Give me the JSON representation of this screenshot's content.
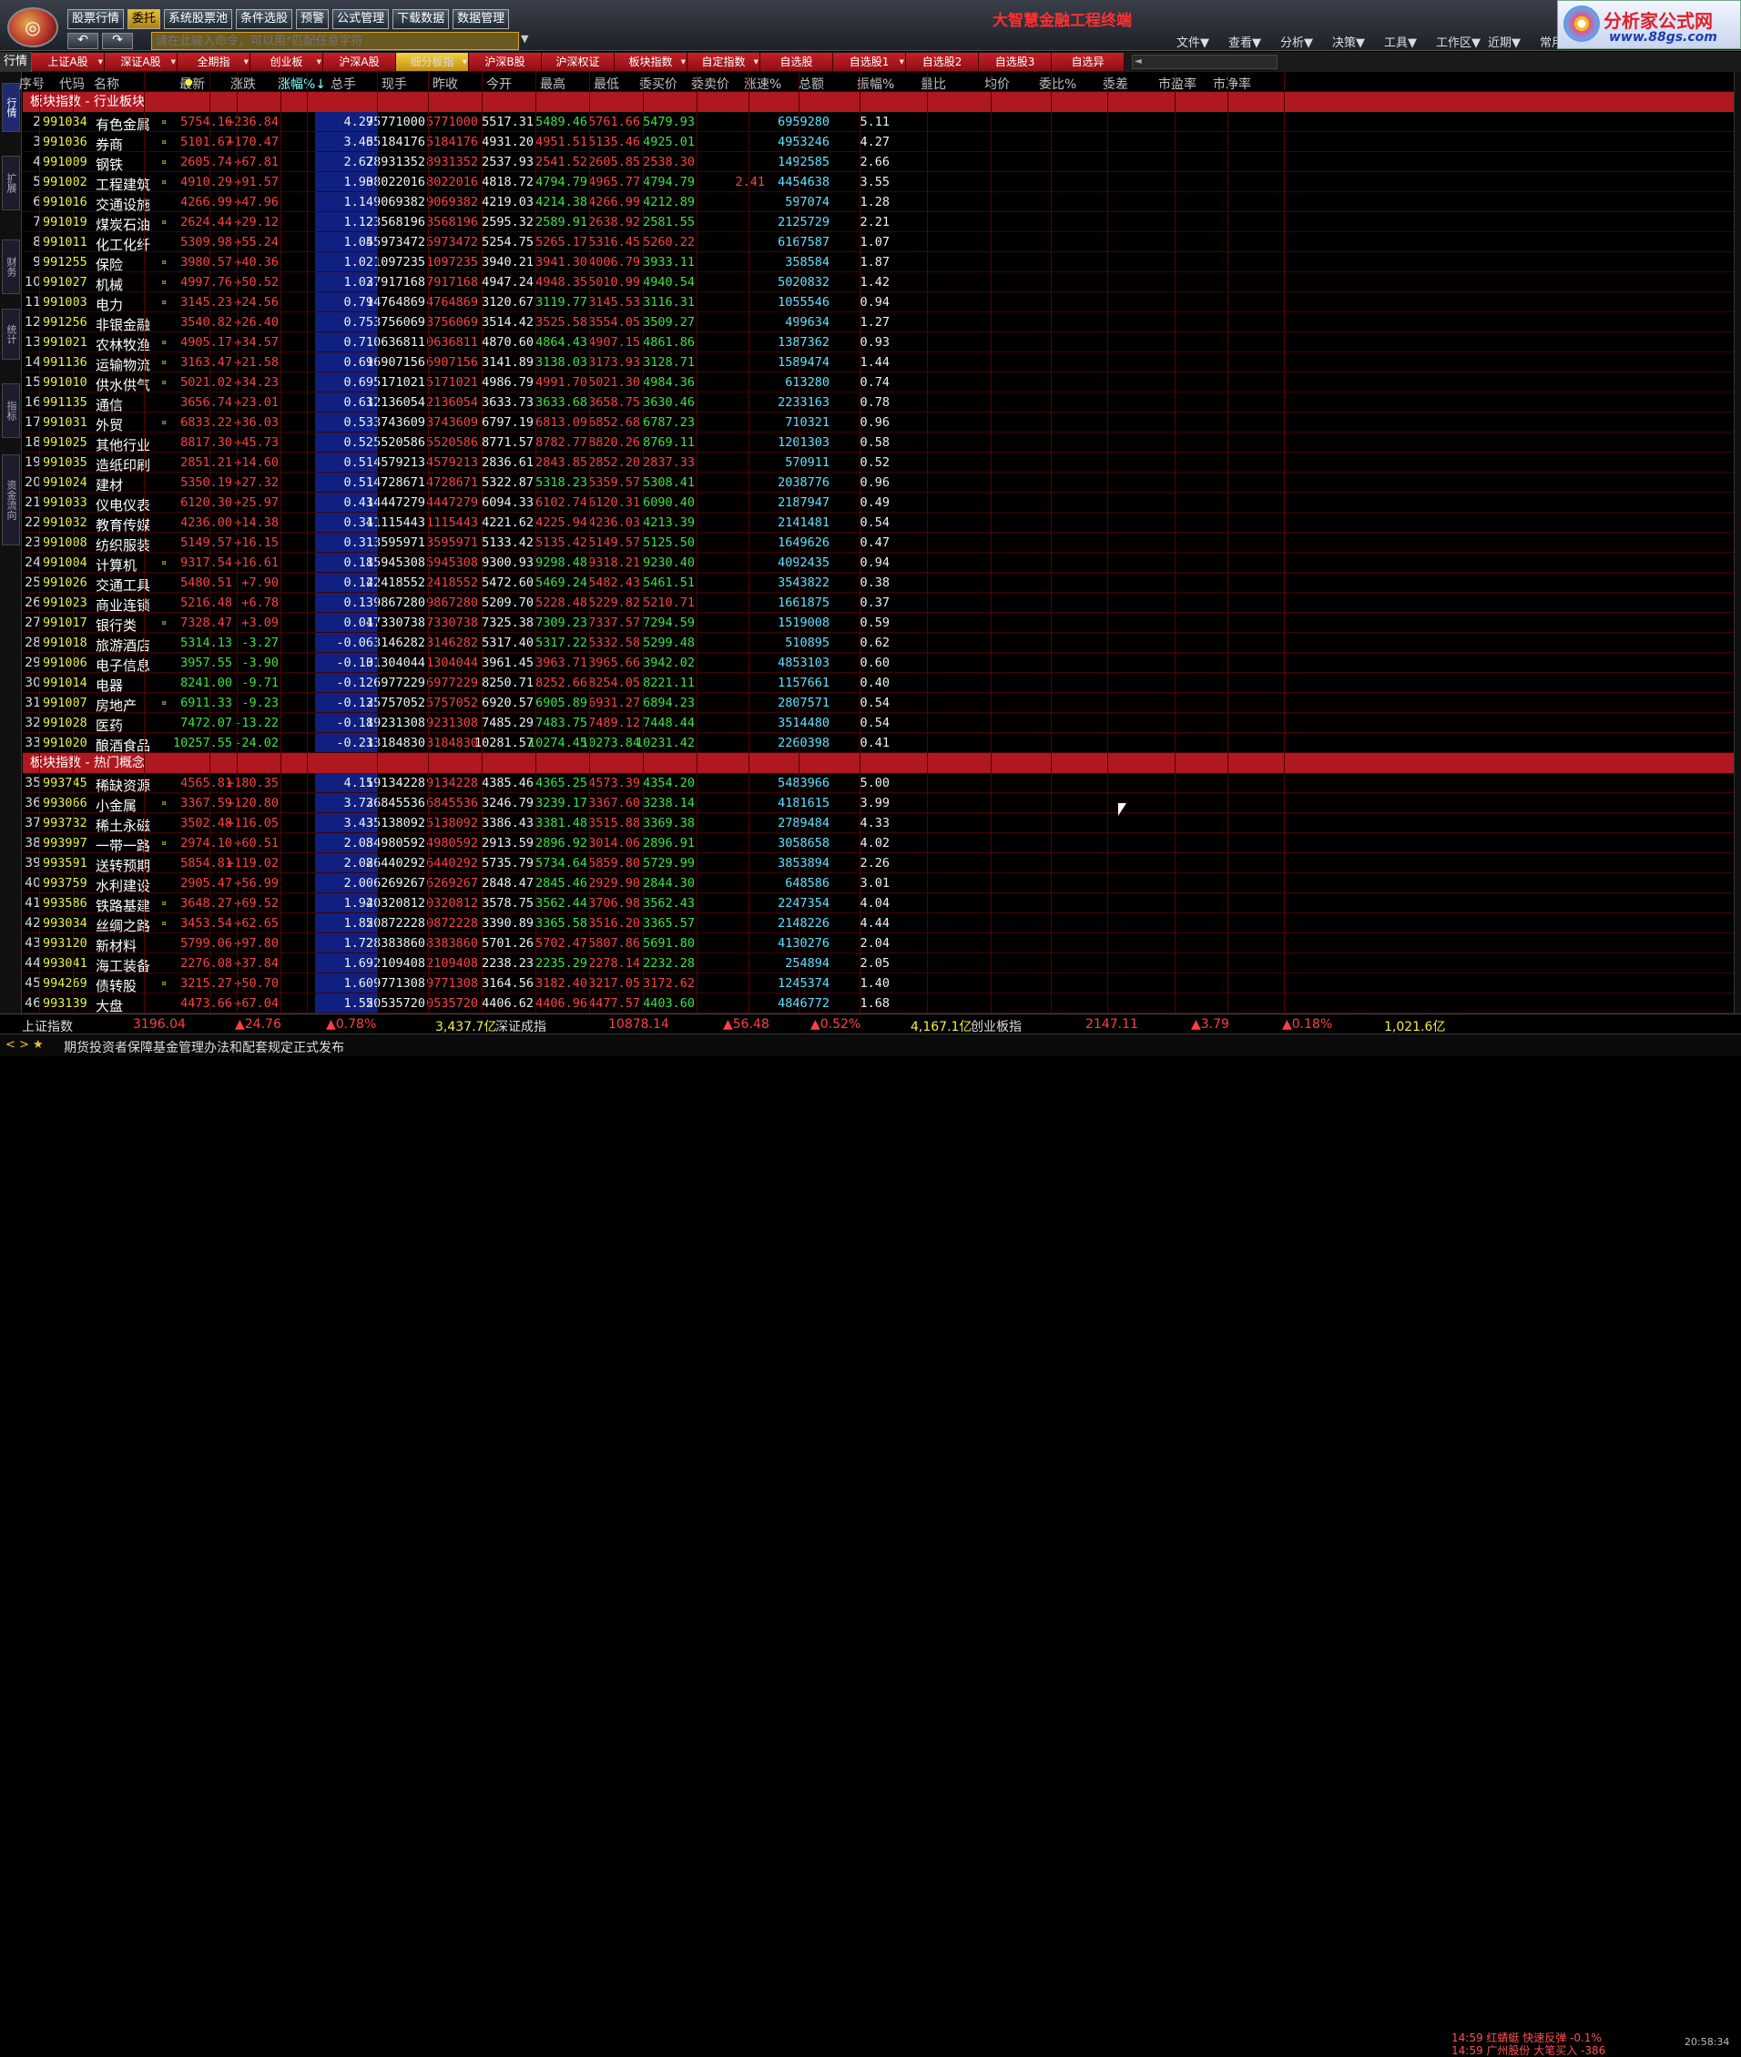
{
  "menu": [
    "股票行情",
    "委托",
    "系统股票池",
    "条件选股",
    "预警",
    "公式管理",
    "下载数据",
    "数据管理"
  ],
  "menu_active": "委托",
  "nav": {
    "back": "↶",
    "forward": "↷"
  },
  "command": {
    "placeholder": "请在此输入命令，可以用*匹配任意字符"
  },
  "app_title": "大智慧金融工程终端",
  "right_menu": [
    "文件▼",
    "查看▼",
    "分析▼",
    "决策▼",
    "工具▼",
    "工作区▼",
    "近期▼",
    "常用"
  ],
  "ad": {
    "line1": "分析家公式网",
    "line2": "www.88gs.com"
  },
  "tab_lead": "行情",
  "tabs": [
    "上证A股",
    "深证A股",
    "全期指",
    "创业板",
    "沪深A股",
    "细分板指",
    "沪深B股",
    "沪深权证",
    "板块指数",
    "自定指数",
    "自选股",
    "自选股1",
    "自选股2",
    "自选股3",
    "自选异"
  ],
  "tab_active": "细分板指",
  "side_tabs": [
    "行情",
    "扩展",
    "财务",
    "统计",
    "指标",
    "资金流向"
  ],
  "headers": [
    "序号",
    "代码",
    "名称",
    "最新",
    "涨跌",
    "涨幅%↓",
    "总手",
    "现手",
    "昨收",
    "今开",
    "最高",
    "最低",
    "委买价",
    "委卖价",
    "涨速%",
    "总额",
    "振幅%",
    "量比",
    "均价",
    "委比%",
    "委差",
    "市盈率",
    "市净率"
  ],
  "sort_header": "涨幅%↓",
  "header_mark": "●",
  "sections": [
    {
      "title": "板块指数 - 行业板块",
      "rows": [
        [
          "2",
          "991034",
          "有色金属",
          "¤",
          "5754.16",
          "+236.84",
          "4.29",
          "75771000",
          "5771000",
          "5517.31",
          "5489.46",
          "5761.66",
          "5479.93",
          "",
          "6959280",
          "5.11"
        ],
        [
          "3",
          "991036",
          "券商",
          "¤",
          "5101.67",
          "+170.47",
          "3.46",
          "35184176",
          "5184176",
          "4931.20",
          "4951.51",
          "5135.46",
          "4925.01",
          "",
          "4953246",
          "4.27"
        ],
        [
          "4",
          "991009",
          "钢铁",
          "¤",
          "2605.74",
          "+67.81",
          "2.67",
          "28931352",
          "8931352",
          "2537.93",
          "2541.52",
          "2605.85",
          "2538.30",
          "",
          "1492585",
          "2.66"
        ],
        [
          "5",
          "991002",
          "工程建筑",
          "¤",
          "4910.29",
          "+91.57",
          "1.90",
          "38022016",
          "8022016",
          "4818.72",
          "4794.79",
          "4965.77",
          "4794.79",
          "2.41",
          "4454638",
          "3.55"
        ],
        [
          "6",
          "991016",
          "交通设施",
          "",
          "4266.99",
          "+47.96",
          "1.14",
          "9069382",
          "9069382",
          "4219.03",
          "4214.38",
          "4266.99",
          "4212.89",
          "",
          "597074",
          "1.28"
        ],
        [
          "7",
          "991019",
          "煤炭石油",
          "¤",
          "2624.44",
          "+29.12",
          "1.12",
          "23568196",
          "3568196",
          "2595.32",
          "2589.91",
          "2638.92",
          "2581.55",
          "",
          "2125729",
          "2.21"
        ],
        [
          "8",
          "991011",
          "化工化纤",
          "",
          "5309.98",
          "+55.24",
          "1.05",
          "45973472",
          "5973472",
          "5254.75",
          "5265.17",
          "5316.45",
          "5260.22",
          "",
          "6167587",
          "1.07"
        ],
        [
          "9",
          "991255",
          "保险",
          "¤",
          "3980.57",
          "+40.36",
          "1.02",
          "1097235",
          "1097235",
          "3940.21",
          "3941.30",
          "4006.79",
          "3933.11",
          "",
          "358584",
          "1.87"
        ],
        [
          "10",
          "991027",
          "机械",
          "¤",
          "4997.76",
          "+50.52",
          "1.02",
          "37917168",
          "7917168",
          "4947.24",
          "4948.35",
          "5010.99",
          "4940.54",
          "",
          "5020832",
          "1.42"
        ],
        [
          "11",
          "991003",
          "电力",
          "¤",
          "3145.23",
          "+24.56",
          "0.79",
          "14764869",
          "4764869",
          "3120.67",
          "3119.77",
          "3145.53",
          "3116.31",
          "",
          "1055546",
          "0.94"
        ],
        [
          "12",
          "991256",
          "非银金融",
          "",
          "3540.82",
          "+26.40",
          "0.75",
          "3756069",
          "3756069",
          "3514.42",
          "3525.58",
          "3554.05",
          "3509.27",
          "",
          "499634",
          "1.27"
        ],
        [
          "13",
          "991021",
          "农林牧渔",
          "¤",
          "4905.17",
          "+34.57",
          "0.71",
          "10636811",
          "0636811",
          "4870.60",
          "4864.43",
          "4907.15",
          "4861.86",
          "",
          "1387362",
          "0.93"
        ],
        [
          "14",
          "991136",
          "运输物流",
          "¤",
          "3163.47",
          "+21.58",
          "0.69",
          "16907156",
          "6907156",
          "3141.89",
          "3138.03",
          "3173.93",
          "3128.71",
          "",
          "1589474",
          "1.44"
        ],
        [
          "15",
          "991010",
          "供水供气",
          "¤",
          "5021.02",
          "+34.23",
          "0.69",
          "5171021",
          "5171021",
          "4986.79",
          "4991.70",
          "5021.30",
          "4984.36",
          "",
          "613280",
          "0.74"
        ],
        [
          "16",
          "991135",
          "通信",
          "",
          "3656.74",
          "+23.01",
          "0.63",
          "12136054",
          "2136054",
          "3633.73",
          "3633.68",
          "3658.75",
          "3630.46",
          "",
          "2233163",
          "0.78"
        ],
        [
          "17",
          "991031",
          "外贸",
          "¤",
          "6833.22",
          "+36.03",
          "0.53",
          "3743609",
          "3743609",
          "6797.19",
          "6813.09",
          "6852.68",
          "6787.23",
          "",
          "710321",
          "0.96"
        ],
        [
          "18",
          "991025",
          "其他行业",
          "",
          "8817.30",
          "+45.73",
          "0.52",
          "5520586",
          "5520586",
          "8771.57",
          "8782.77",
          "8820.26",
          "8769.11",
          "",
          "1201303",
          "0.58"
        ],
        [
          "19",
          "991035",
          "造纸印刷",
          "",
          "2851.21",
          "+14.60",
          "0.51",
          "4579213",
          "4579213",
          "2836.61",
          "2843.85",
          "2852.20",
          "2837.33",
          "",
          "570911",
          "0.52"
        ],
        [
          "20",
          "991024",
          "建材",
          "",
          "5350.19",
          "+27.32",
          "0.51",
          "14728671",
          "4728671",
          "5322.87",
          "5318.23",
          "5359.57",
          "5308.41",
          "",
          "2038776",
          "0.96"
        ],
        [
          "21",
          "991033",
          "仪电仪表",
          "",
          "6120.30",
          "+25.97",
          "0.43",
          "14447279",
          "4447279",
          "6094.33",
          "6102.74",
          "6120.31",
          "6090.40",
          "",
          "2187947",
          "0.49"
        ],
        [
          "22",
          "991032",
          "教育传媒",
          "",
          "4236.00",
          "+14.38",
          "0.34",
          "11115443",
          "1115443",
          "4221.62",
          "4225.94",
          "4236.03",
          "4213.39",
          "",
          "2141481",
          "0.54"
        ],
        [
          "23",
          "991008",
          "纺织服装",
          "",
          "5149.57",
          "+16.15",
          "0.31",
          "13595971",
          "3595971",
          "5133.42",
          "5135.42",
          "5149.57",
          "5125.50",
          "",
          "1649626",
          "0.47"
        ],
        [
          "24",
          "991004",
          "计算机",
          "¤",
          "9317.54",
          "+16.61",
          "0.18",
          "15945308",
          "5945308",
          "9300.93",
          "9298.48",
          "9318.21",
          "9230.40",
          "",
          "4092435",
          "0.94"
        ],
        [
          "25",
          "991026",
          "交通工具",
          "",
          "5480.51",
          "+7.90",
          "0.14",
          "22418552",
          "2418552",
          "5472.60",
          "5469.24",
          "5482.43",
          "5461.51",
          "",
          "3543822",
          "0.38"
        ],
        [
          "26",
          "991023",
          "商业连锁",
          "",
          "5216.48",
          "+6.78",
          "0.13",
          "9867280",
          "9867280",
          "5209.70",
          "5228.48",
          "5229.82",
          "5210.71",
          "",
          "1661875",
          "0.37"
        ],
        [
          "27",
          "991017",
          "银行类",
          "¤",
          "7328.47",
          "+3.09",
          "0.04",
          "17330738",
          "7330738",
          "7325.38",
          "7309.23",
          "7337.57",
          "7294.59",
          "",
          "1519008",
          "0.59"
        ],
        [
          "28",
          "991018",
          "旅游酒店",
          "",
          "5314.13",
          "-3.27",
          "-0.06",
          "3146282",
          "3146282",
          "5317.40",
          "5317.22",
          "5332.58",
          "5299.48",
          "",
          "510895",
          "0.62"
        ],
        [
          "29",
          "991006",
          "电子信息",
          "",
          "3957.55",
          "-3.90",
          "-0.10",
          "31304044",
          "1304044",
          "3961.45",
          "3963.71",
          "3965.66",
          "3942.02",
          "",
          "4853103",
          "0.60"
        ],
        [
          "30",
          "991014",
          "电器",
          "",
          "8241.00",
          "-9.71",
          "-0.12",
          "6977229",
          "6977229",
          "8250.71",
          "8252.66",
          "8254.05",
          "8221.11",
          "",
          "1157661",
          "0.40"
        ],
        [
          "31",
          "991007",
          "房地产",
          "¤",
          "6911.33",
          "-9.23",
          "-0.13",
          "25757052",
          "5757052",
          "6920.57",
          "6905.89",
          "6931.27",
          "6894.23",
          "",
          "2807571",
          "0.54"
        ],
        [
          "32",
          "991028",
          "医药",
          "",
          "7472.07",
          "-13.22",
          "-0.18",
          "19231308",
          "9231308",
          "7485.29",
          "7483.75",
          "7489.12",
          "7448.44",
          "",
          "3514480",
          "0.54"
        ],
        [
          "33",
          "991020",
          "酿酒食品",
          "",
          "10257.55",
          "-24.02",
          "-0.23",
          "13184830",
          "3184830",
          "10281.57",
          "10274.45",
          "10273.84",
          "10231.42",
          "",
          "2260398",
          "0.41"
        ]
      ]
    },
    {
      "title": "板块指数 - 热门概念",
      "rows": [
        [
          "35",
          "993745",
          "稀缺资源",
          "",
          "4565.81",
          "+180.35",
          "4.11",
          "59134228",
          "9134228",
          "4385.46",
          "4365.25",
          "4573.39",
          "4354.20",
          "",
          "5483966",
          "5.00"
        ],
        [
          "36",
          "993066",
          "小金属",
          "¤",
          "3367.59",
          "+120.80",
          "3.72",
          "36845536",
          "6845536",
          "3246.79",
          "3239.17",
          "3367.60",
          "3238.14",
          "",
          "4181615",
          "3.99"
        ],
        [
          "37",
          "993732",
          "稀土永磁",
          "",
          "3502.48",
          "+116.05",
          "3.43",
          "35138092",
          "5138092",
          "3386.43",
          "3381.48",
          "3515.88",
          "3369.38",
          "",
          "2789484",
          "4.33"
        ],
        [
          "38",
          "993997",
          "一带一路",
          "¤",
          "2974.10",
          "+60.51",
          "2.08",
          "34980592",
          "4980592",
          "2913.59",
          "2896.92",
          "3014.06",
          "2896.91",
          "",
          "3058658",
          "4.02"
        ],
        [
          "39",
          "993591",
          "送转预期",
          "",
          "5854.81",
          "+119.02",
          "2.08",
          "26440292",
          "6440292",
          "5735.79",
          "5734.64",
          "5859.80",
          "5729.99",
          "",
          "3853894",
          "2.26"
        ],
        [
          "40",
          "993759",
          "水利建设",
          "",
          "2905.47",
          "+56.99",
          "2.00",
          "6269267",
          "6269267",
          "2848.47",
          "2845.46",
          "2929.90",
          "2844.30",
          "",
          "648586",
          "3.01"
        ],
        [
          "41",
          "993586",
          "铁路基建",
          "¤",
          "3648.27",
          "+69.52",
          "1.94",
          "20320812",
          "0320812",
          "3578.75",
          "3562.44",
          "3706.98",
          "3562.43",
          "",
          "2247354",
          "4.04"
        ],
        [
          "42",
          "993034",
          "丝绸之路",
          "¤",
          "3453.54",
          "+62.65",
          "1.85",
          "20872228",
          "0872228",
          "3390.89",
          "3365.58",
          "3516.20",
          "3365.57",
          "",
          "2148226",
          "4.44"
        ],
        [
          "43",
          "993120",
          "新材料",
          "",
          "5799.06",
          "+97.80",
          "1.72",
          "28383860",
          "8383860",
          "5701.26",
          "5702.47",
          "5807.86",
          "5691.80",
          "",
          "4130276",
          "2.04"
        ],
        [
          "44",
          "993041",
          "海工装备",
          "",
          "2276.08",
          "+37.84",
          "1.69",
          "2109408",
          "2109408",
          "2238.23",
          "2235.29",
          "2278.14",
          "2232.28",
          "",
          "254894",
          "2.05"
        ],
        [
          "45",
          "994269",
          "债转股",
          "¤",
          "3215.27",
          "+50.70",
          "1.60",
          "9771308",
          "9771308",
          "3164.56",
          "3182.40",
          "3217.05",
          "3172.62",
          "",
          "1245374",
          "1.40"
        ],
        [
          "46",
          "993139",
          "大盘",
          "",
          "4473.66",
          "+67.04",
          "1.52",
          "50535720",
          "0535720",
          "4406.62",
          "4406.96",
          "4477.57",
          "4403.60",
          "",
          "4846772",
          "1.68"
        ]
      ]
    }
  ],
  "status": {
    "sh_name": "上证指数",
    "sh_price": "3196.04",
    "sh_chg": "▲24.76",
    "sh_pct": "▲0.78%",
    "sh_amt": "3,437.7亿",
    "sz_name": "深证成指",
    "sz_price": "10878.14",
    "sz_chg": "▲56.48",
    "sz_pct": "▲0.52%",
    "sz_amt": "4,167.1亿",
    "cy_name": "创业板指",
    "cy_price": "2147.11",
    "cy_chg": "▲3.79",
    "cy_pct": "▲0.18%",
    "cy_amt": "1,021.6亿"
  },
  "news": {
    "nav": "< > ★",
    "text": "期货投资者保障基金管理办法和配套规定正式发布"
  },
  "alert": {
    "line1": "14:59 红蜻蜓  快速反弹 -0.1%",
    "line2": "14:59 广州股份 大笔买入 -386"
  },
  "clock": "20:58:34",
  "colors": {
    "up": "#ff4040",
    "down": "#40e040",
    "section": "#b01820",
    "tab": "#c82028"
  }
}
